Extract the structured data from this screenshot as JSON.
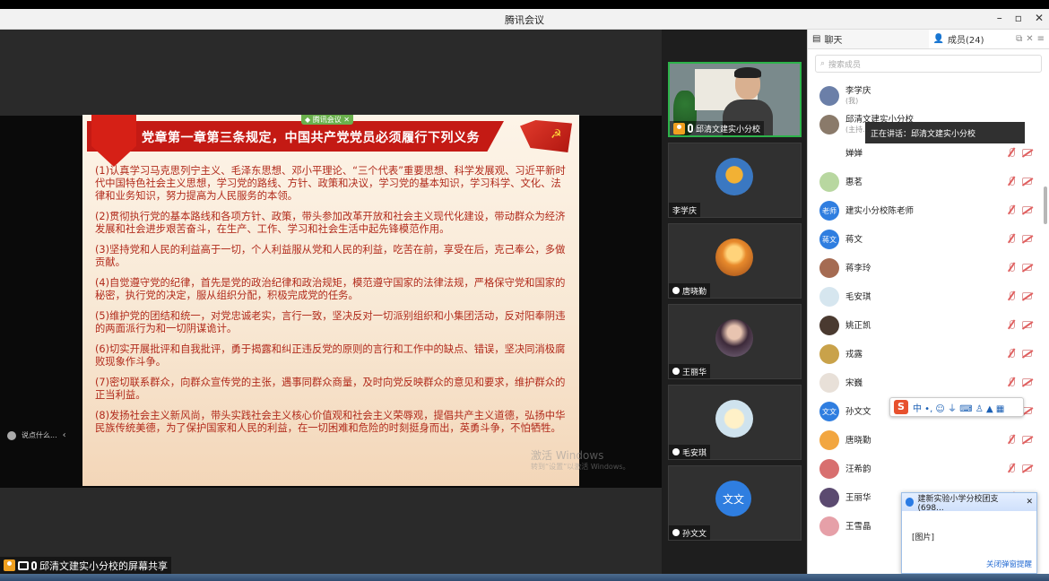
{
  "window": {
    "title": "腾讯会议",
    "minimize": "–",
    "restore": "▫",
    "close": "✕"
  },
  "slide": {
    "corner_tag": "◆ 腾讯会议 ✕",
    "heading": "党章第一章第三条规定，中国共产党党员必须履行下列义务",
    "items": [
      "(1)认真学习马克思列宁主义、毛泽东思想、邓小平理论、“三个代表”重要思想、科学发展观、习近平新时代中国特色社会主义思想，学习党的路线、方针、政策和决议，学习党的基本知识，学习科学、文化、法律和业务知识，努力提高为人民服务的本领。",
      "(2)贯彻执行党的基本路线和各项方针、政策，带头参加改革开放和社会主义现代化建设，带动群众为经济发展和社会进步艰苦奋斗，在生产、工作、学习和社会生活中起先锋模范作用。",
      "(3)坚持党和人民的利益高于一切，个人利益服从党和人民的利益，吃苦在前，享受在后，克己奉公，多做贡献。",
      "(4)自觉遵守党的纪律，首先是党的政治纪律和政治规矩，模范遵守国家的法律法规，严格保守党和国家的秘密，执行党的决定，服从组织分配，积极完成党的任务。",
      "(5)维护党的团结和统一，对党忠诚老实，言行一致，坚决反对一切派别组织和小集团活动，反对阳奉阴违的两面派行为和一切阴谋诡计。",
      "(6)切实开展批评和自我批评，勇于揭露和纠正违反党的原则的言行和工作中的缺点、错误，坚决同消极腐败现象作斗争。",
      "(7)密切联系群众，向群众宣传党的主张，遇事同群众商量，及时向党反映群众的意见和要求，维护群众的正当利益。",
      "(8)发扬社会主义新风尚，带头实践社会主义核心价值观和社会主义荣辱观，提倡共产主义道德，弘扬中华民族传统美德，为了保护国家和人民的利益，在一切困难和危险的时刻挺身而出，英勇斗争，不怕牺牲。"
    ]
  },
  "watermark": {
    "line1": "激活 Windows",
    "line2": "转到“设置”以激活 Windows。"
  },
  "chat_preview": {
    "text": "说点什么...",
    "arrow": "‹"
  },
  "share_label": "邱清文建实小分校的屏幕共享",
  "videos": [
    {
      "name": "邱清文建实小分校",
      "initial": ""
    },
    {
      "name": "李学庆",
      "initial": ""
    },
    {
      "name": "唐晓勤",
      "initial": ""
    },
    {
      "name": "王丽华",
      "initial": ""
    },
    {
      "name": "毛安琪",
      "initial": ""
    },
    {
      "name": "孙文文",
      "initial": "文文"
    }
  ],
  "panel": {
    "tab_chat": "聊天",
    "tab_members": "成员(24)",
    "search_placeholder": "搜索成员",
    "members": [
      {
        "name": "李学庆",
        "sub": "(我)",
        "avatar_text": "",
        "color": "#6b7fa8"
      },
      {
        "name": "邱清文建实小分校",
        "sub": "(主持...",
        "avatar_text": "",
        "color": "#8a7a6a"
      },
      {
        "name": "婵婵",
        "sub": "",
        "avatar_text": "",
        "color": "#ffffff"
      },
      {
        "name": "惠茗",
        "sub": "",
        "avatar_text": "",
        "color": "#b8d7a0"
      },
      {
        "name": "建实小分校陈老师",
        "sub": "",
        "avatar_text": "老师",
        "color": "#2f7ee0"
      },
      {
        "name": "蒋文",
        "sub": "",
        "avatar_text": "蒋文",
        "color": "#2f7ee0"
      },
      {
        "name": "蒋李玲",
        "sub": "",
        "avatar_text": "",
        "color": "#a56b52"
      },
      {
        "name": "毛安琪",
        "sub": "",
        "avatar_text": "",
        "color": "#d6e6ef"
      },
      {
        "name": "姚正凯",
        "sub": "",
        "avatar_text": "",
        "color": "#4a3a30"
      },
      {
        "name": "戎露",
        "sub": "",
        "avatar_text": "",
        "color": "#c9a24a"
      },
      {
        "name": "宋巍",
        "sub": "",
        "avatar_text": "",
        "color": "#e8e0d8"
      },
      {
        "name": "孙文文",
        "sub": "",
        "avatar_text": "文文",
        "color": "#2f7ee0"
      },
      {
        "name": "唐晓勤",
        "sub": "",
        "avatar_text": "",
        "color": "#f2a640"
      },
      {
        "name": "汪希韵",
        "sub": "",
        "avatar_text": "",
        "color": "#d86f6f"
      },
      {
        "name": "王丽华",
        "sub": "",
        "avatar_text": "",
        "color": "#5b4a70"
      },
      {
        "name": "王雪晶",
        "sub": "",
        "avatar_text": "",
        "color": "#e6a0a8"
      }
    ]
  },
  "speaking_tooltip": "正在讲话：邱清文建实小分校",
  "ime": {
    "logo": "S",
    "text": "中 •, ☺ ⏚ ⌨ ♙ ▲ ▦"
  },
  "notify": {
    "title": "建新实验小学分校团支(698...",
    "body": "[图片]",
    "close": "✕",
    "footer": "关闭弹窗提醒"
  }
}
